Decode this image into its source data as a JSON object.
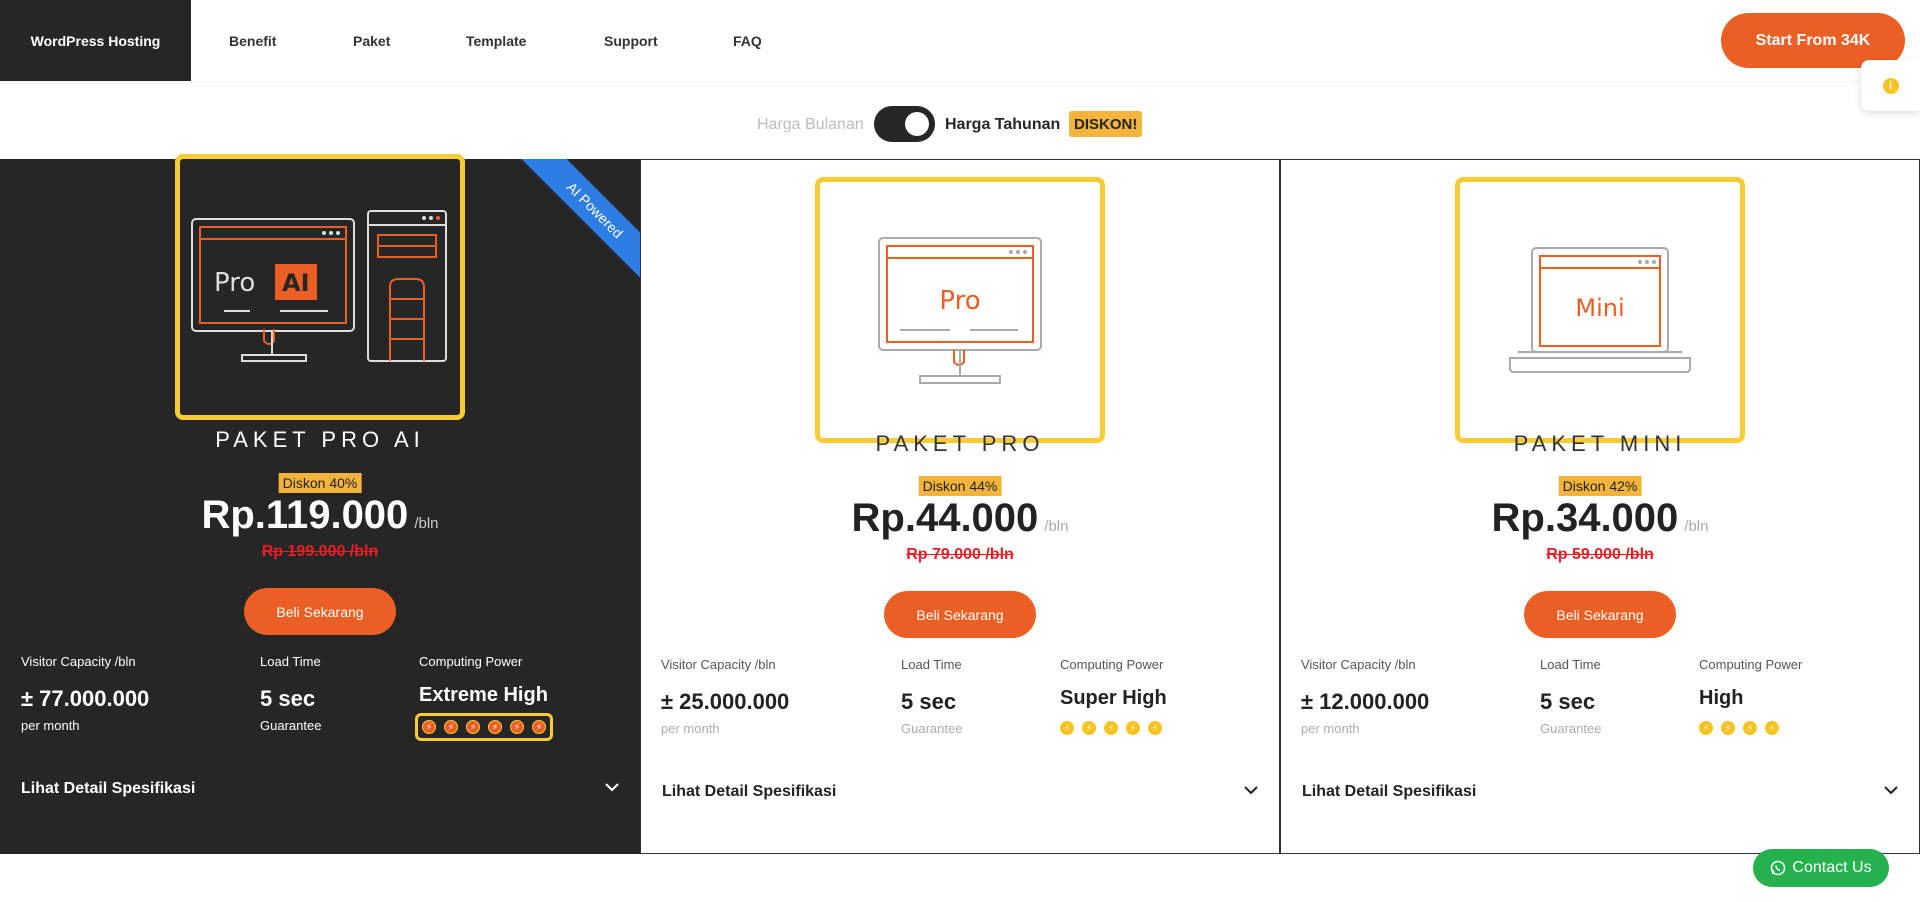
{
  "nav": {
    "brand": "WordPress Hosting",
    "links": [
      "Benefit",
      "Paket",
      "Template",
      "Support",
      "FAQ"
    ],
    "cta": "Start From 34K"
  },
  "toggle": {
    "monthly": "Harga Bulanan",
    "yearly": "Harga Tahunan",
    "badge": "DISKON!",
    "state": "yearly"
  },
  "spec_labels": {
    "visitor": "Visitor Capacity /bln",
    "load": "Load Time",
    "computing": "Computing Power"
  },
  "plans": [
    {
      "ribbon": "AI Powered",
      "illustration_text": [
        "Pro",
        "AI"
      ],
      "name": "PAKET PRO AI",
      "discount": "Diskon 40%",
      "price": "Rp.119.000",
      "per": "/bln",
      "old_price": "Rp 199.000 /bln",
      "buy": "Beli Sekarang",
      "visitor": "± 77.000.000",
      "visitor_sub": "per month",
      "load": "5 sec",
      "load_sub": "Guarantee",
      "computing": "Extreme High",
      "power_level": 6,
      "detail": "Lihat Detail Spesifikasi"
    },
    {
      "illustration_text": [
        "Pro"
      ],
      "name": "PAKET PRO",
      "discount": "Diskon 44%",
      "price": "Rp.44.000",
      "per": "/bln",
      "old_price": "Rp 79.000 /bln",
      "buy": "Beli Sekarang",
      "visitor": "± 25.000.000",
      "visitor_sub": "per month",
      "load": "5 sec",
      "load_sub": "Guarantee",
      "computing": "Super High",
      "power_level": 5,
      "detail": "Lihat Detail Spesifikasi"
    },
    {
      "illustration_text": [
        "Mini"
      ],
      "name": "PAKET MINI",
      "discount": "Diskon 42%",
      "price": "Rp.34.000",
      "per": "/bln",
      "old_price": "Rp 59.000 /bln",
      "buy": "Beli Sekarang",
      "visitor": "± 12.000.000",
      "visitor_sub": "per month",
      "load": "5 sec",
      "load_sub": "Guarantee",
      "computing": "High",
      "power_level": 4,
      "detail": "Lihat Detail Spesifikasi"
    }
  ],
  "contact": "Contact Us",
  "colors": {
    "accent": "#ec5f24",
    "dark": "#262626",
    "highlight": "#f7cd33",
    "discount_bg": "#f2b43a",
    "strike": "#ee1c25",
    "ribbon": "#2e7de3",
    "whatsapp": "#25b24e"
  }
}
